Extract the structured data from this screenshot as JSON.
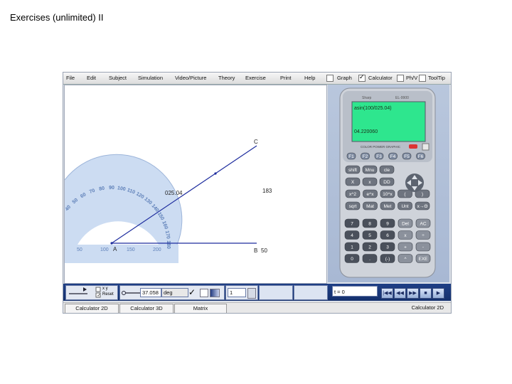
{
  "slide": {
    "title": "Exercises (unlimited) II"
  },
  "menu": {
    "items": [
      "File",
      "Edit",
      "Subject",
      "Simulation",
      "Video/Picture",
      "Theory",
      "Exercise",
      "Print",
      "Help"
    ],
    "toggles": [
      {
        "label": "Graph",
        "checked": false
      },
      {
        "label": "Calculator",
        "checked": true
      },
      {
        "label": "Ph/V",
        "checked": false
      },
      {
        "label": "ToolTip",
        "checked": false
      }
    ]
  },
  "canvas": {
    "point_c": "C",
    "point_b": "B",
    "point_a": "A",
    "b_value": "50",
    "angle_label": "025.04",
    "side_label": "183",
    "protractor_labels": [
      "10",
      "20",
      "30",
      "40",
      "50",
      "60",
      "70",
      "80",
      "90",
      "100",
      "110",
      "120",
      "130",
      "140",
      "150",
      "160",
      "170",
      "180"
    ],
    "ruler_labels": [
      "50",
      "100",
      "150",
      "200"
    ]
  },
  "calculator": {
    "brand": "Sharp",
    "model": "EL-9900",
    "screen_line1": "asin(100/025.04)",
    "screen_line2": "04.220060",
    "banner": "COLOR POWER GRAPHIC",
    "fkeys": [
      "F1",
      "F2",
      "F3",
      "F4",
      "F5",
      "F6"
    ],
    "row1": [
      "shift",
      "Mnu",
      "cle"
    ],
    "row2": [
      "X",
      "x",
      "DD"
    ],
    "row3": [
      "x^2",
      "e^x",
      "10^x",
      "(",
      ")"
    ],
    "row4": [
      "sqrt",
      "Mat",
      "Met",
      "Unt",
      "x→Θ"
    ],
    "keypad": [
      [
        "7",
        "8",
        "9",
        "Del",
        "AC"
      ],
      [
        "4",
        "5",
        "6",
        "x",
        "÷"
      ],
      [
        "1",
        "2",
        "3",
        "+",
        "-"
      ],
      [
        "0",
        ".",
        "(-)",
        "^",
        "EXE"
      ]
    ],
    "screen_color": "#2ee68e"
  },
  "bottom": {
    "xy_label": "x y",
    "reset_label": "Reset",
    "angle_value": "37.058",
    "angle_unit": "deg",
    "field_value": "1",
    "t_value": "t = 0"
  },
  "tabs": {
    "items": [
      "Calculator 2D",
      "Calculator 3D",
      "Matrix"
    ],
    "status": "Calculator 2D"
  }
}
